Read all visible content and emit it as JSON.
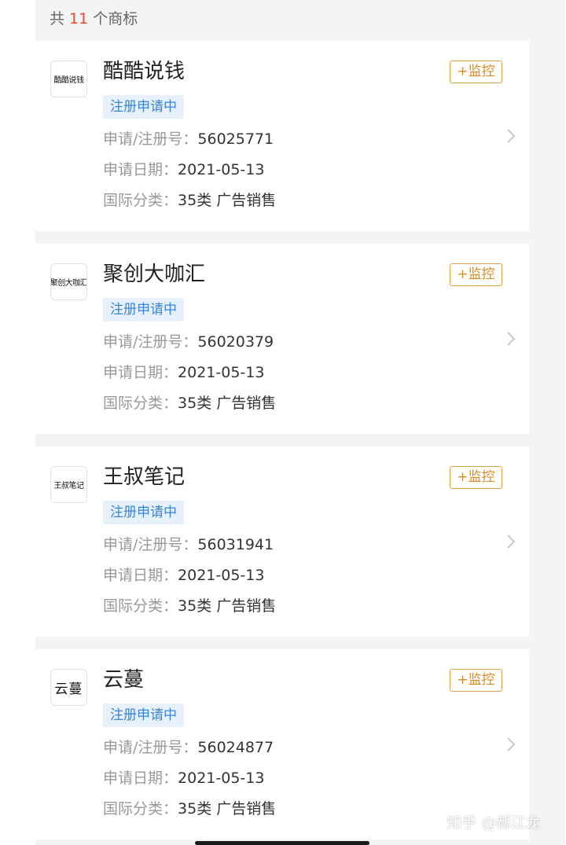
{
  "summary": {
    "prefix": "共",
    "count": "11",
    "suffix": "个商标"
  },
  "cards": [
    {
      "logo_text": "酷酷说钱",
      "title": "酷酷说钱",
      "status": "注册申请中",
      "monitor_label": "+监控",
      "reg_label": "申请/注册号：",
      "reg_no": "56025771",
      "date_label": "申请日期：",
      "date": "2021-05-13",
      "class_label": "国际分类：",
      "class": "35类 广告销售"
    },
    {
      "logo_text": "聚创大咖汇",
      "title": "聚创大咖汇",
      "status": "注册申请中",
      "monitor_label": "+监控",
      "reg_label": "申请/注册号：",
      "reg_no": "56020379",
      "date_label": "申请日期：",
      "date": "2021-05-13",
      "class_label": "国际分类：",
      "class": "35类 广告销售"
    },
    {
      "logo_text": "王叔笔记",
      "title": "王叔笔记",
      "status": "注册申请中",
      "monitor_label": "+监控",
      "reg_label": "申请/注册号：",
      "reg_no": "56031941",
      "date_label": "申请日期：",
      "date": "2021-05-13",
      "class_label": "国际分类：",
      "class": "35类 广告销售"
    },
    {
      "logo_text": "云蔓",
      "title": "云蔓",
      "status": "注册申请中",
      "monitor_label": "+监控",
      "reg_label": "申请/注册号：",
      "reg_no": "56024877",
      "date_label": "申请日期：",
      "date": "2021-05-13",
      "class_label": "国际分类：",
      "class": "35类 广告销售"
    }
  ],
  "watermark": "知乎 @郝江龙",
  "colors": {
    "accent_orange": "#e08a20",
    "status_blue": "#3d84d0",
    "count_red": "#e64a3b"
  },
  "icons": {
    "chevron": "chevron-right-icon"
  }
}
